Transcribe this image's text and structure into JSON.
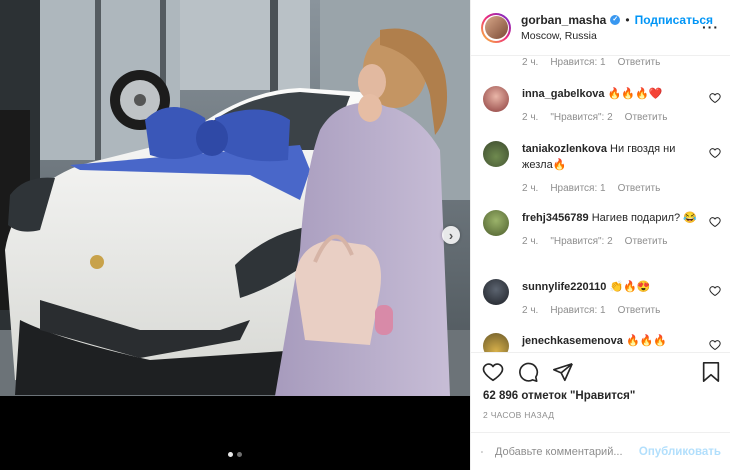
{
  "post": {
    "username": "gorban_masha",
    "follow_label": "Подписаться",
    "separator": "•",
    "location": "Moscow, Russia",
    "more_label": "···"
  },
  "first_comment_meta": {
    "time": "2 ч.",
    "likes": "Нравится: 1",
    "reply": "Ответить"
  },
  "comments": [
    {
      "user": "inna_gabelkova",
      "text": "🔥🔥🔥❤️",
      "time": "",
      "likes": "",
      "reply": ""
    },
    {
      "user": "taniakozlenkova",
      "text": "Ни гвоздя ни жезла🔥",
      "time": "2 ч.",
      "likes": "Нравится: 1",
      "reply": "Ответить"
    },
    {
      "user": "frehj3456789",
      "text": "Нагиев подарил? 😂",
      "time": "2 ч.",
      "likes": "\"Нравится\": 2",
      "reply": "Ответить"
    },
    {
      "user": "sunnylife220110",
      "text": "👏🔥😍",
      "time": "2 ч.",
      "likes": "Нравится: 1",
      "reply": "Ответить"
    },
    {
      "user": "jenechkasemenova",
      "text": "🔥🔥🔥",
      "time": "",
      "likes": "",
      "reply": ""
    }
  ],
  "comments_meta_row1": {
    "time": "2 ч.",
    "likes": "\"Нравится\": 2",
    "reply": "Ответить"
  },
  "likes_text": "62 896 отметок \"Нравится\"",
  "time_ago": "2 ЧАСОВ НАЗАД",
  "add_comment": {
    "placeholder": "Добавьте комментарий...",
    "post_label": "Опубликовать"
  },
  "icons": {
    "like": "heart-icon",
    "comment": "comment-icon",
    "share": "paper-plane-icon",
    "save": "bookmark-icon",
    "emoji": "smiley-icon",
    "verified": "verified-badge-icon",
    "next": "chevron-right-icon"
  },
  "colors": {
    "link": "#0095f6",
    "post_button": "#b2dffc",
    "muted": "#8e8e8e",
    "verified": "#3897f0"
  },
  "carousel": {
    "count": 2,
    "active": 1
  }
}
